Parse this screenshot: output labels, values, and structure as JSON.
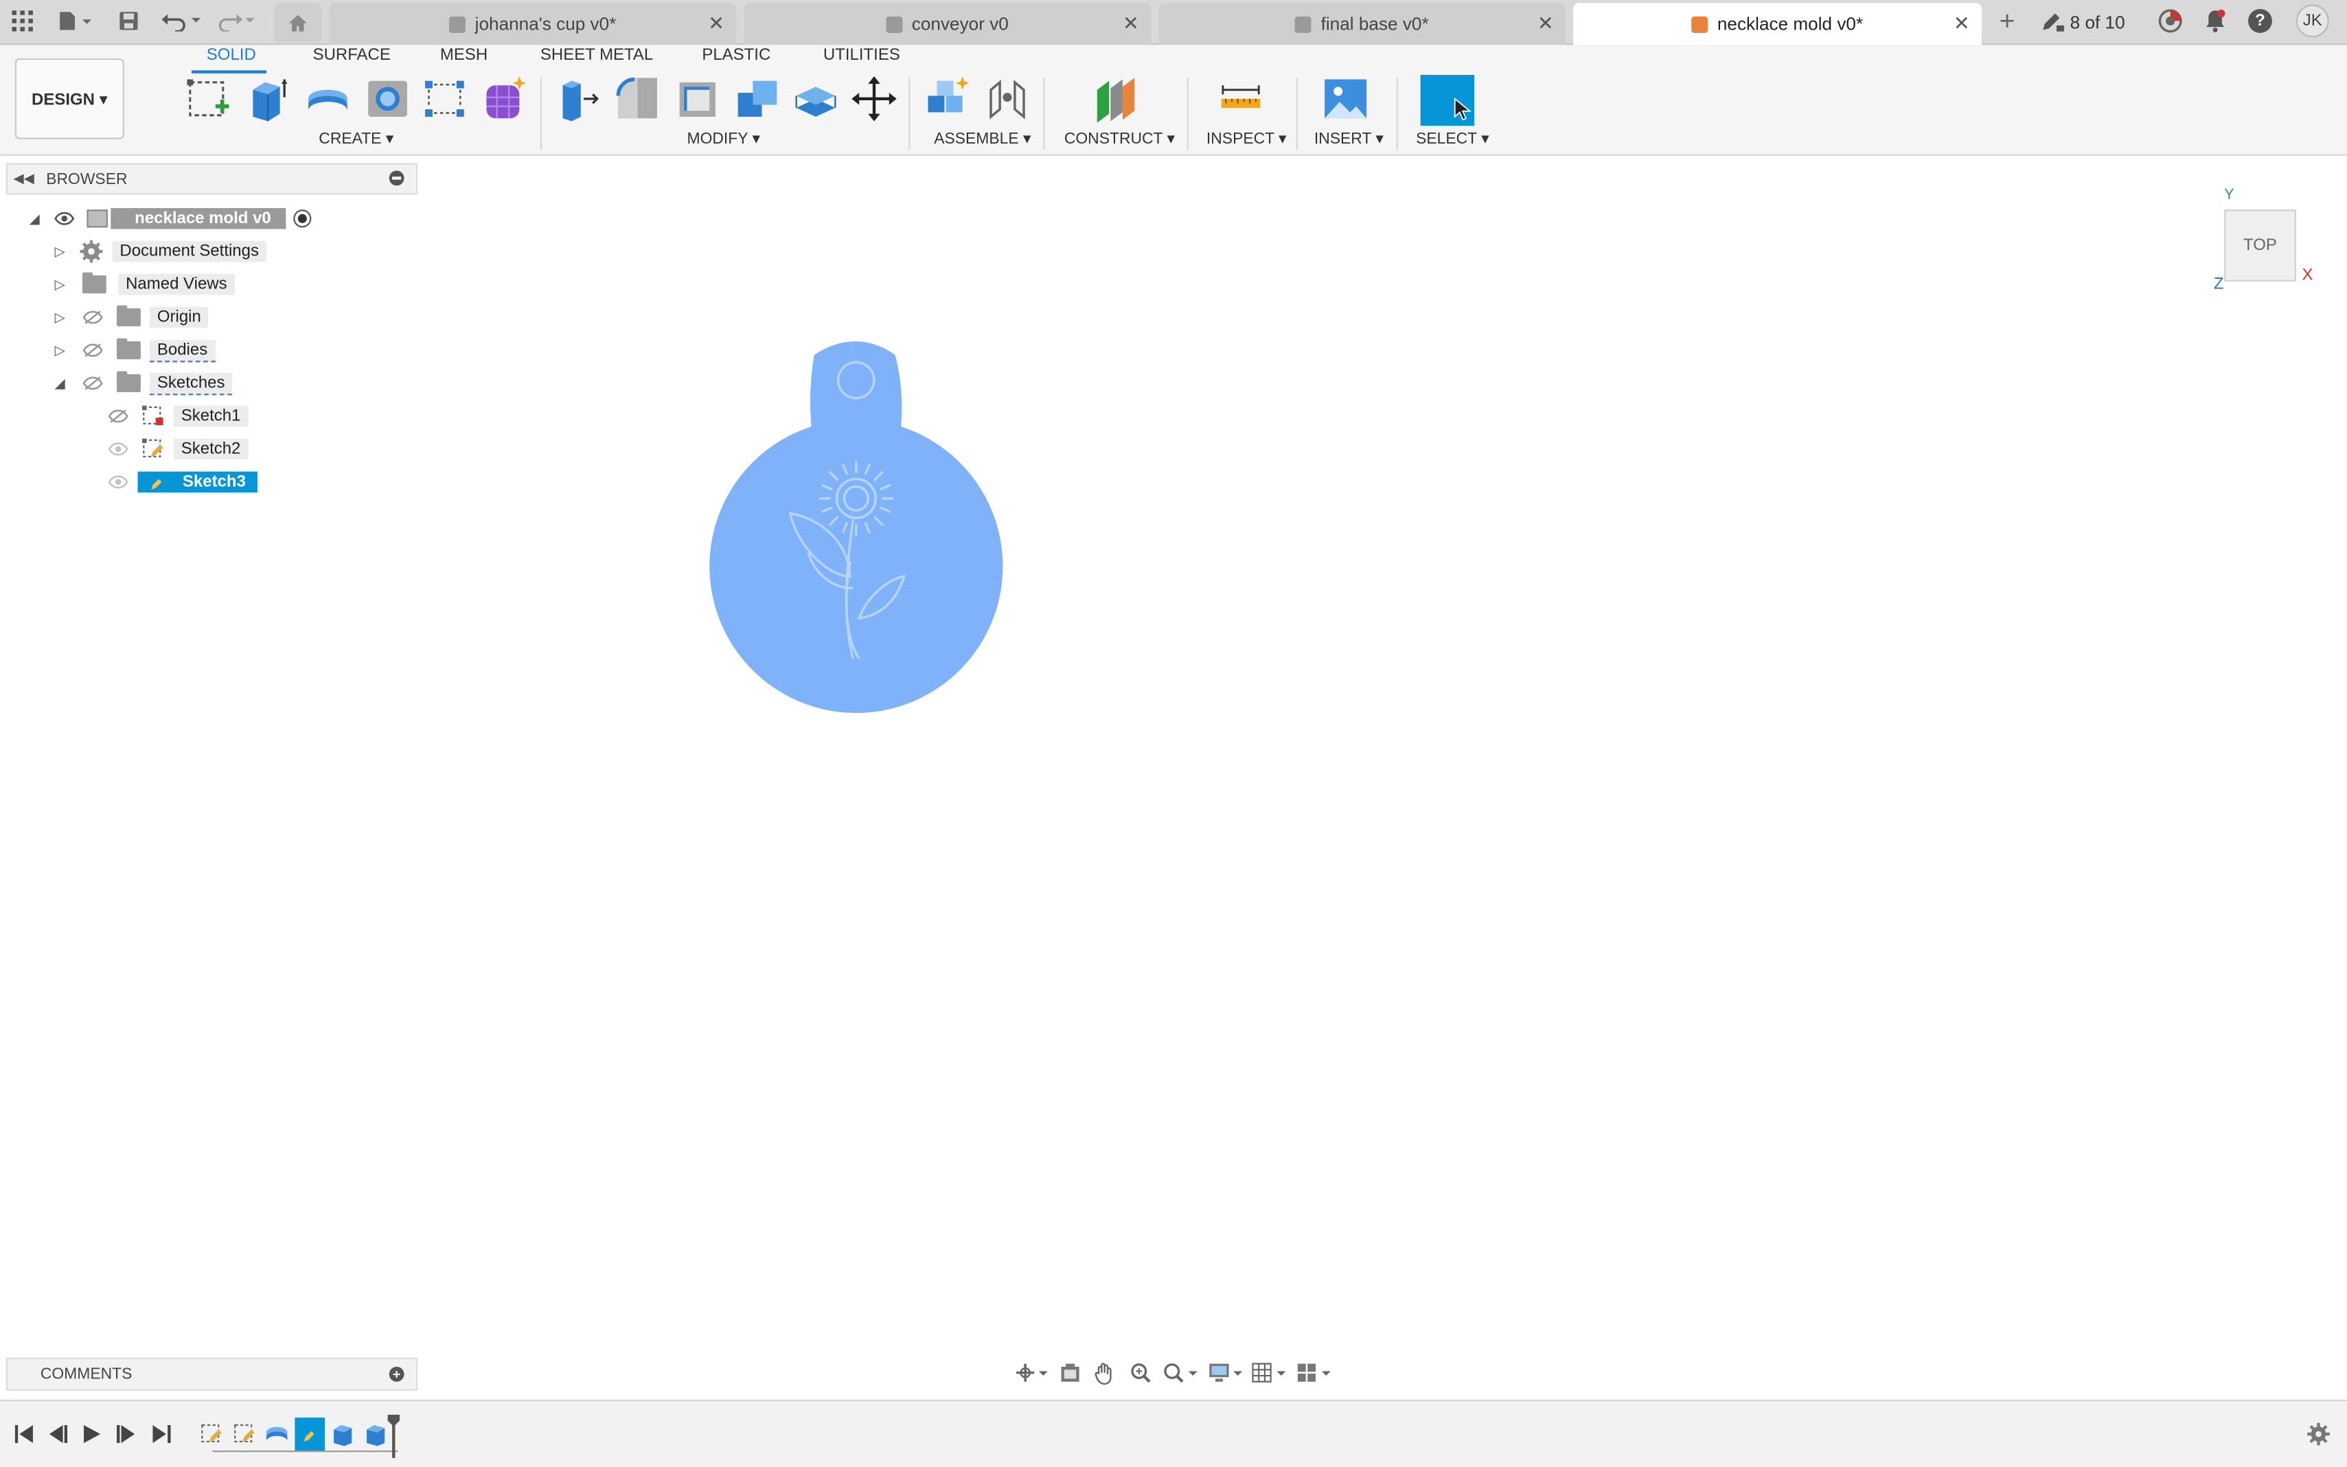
{
  "tabbar": {
    "tabs": [
      {
        "label": "johanna's cup v0*",
        "active": false
      },
      {
        "label": "conveyor v0",
        "active": false
      },
      {
        "label": "final base v0*",
        "active": false
      },
      {
        "label": "necklace mold v0*",
        "active": true
      }
    ],
    "close_glyph": "✕",
    "add_glyph": "+",
    "page_counter": "8 of 10",
    "user_initials": "JK",
    "help_glyph": "?"
  },
  "toolbar": {
    "design_label": "DESIGN ▾",
    "workspace_tabs": [
      "SOLID",
      "SURFACE",
      "MESH",
      "SHEET METAL",
      "PLASTIC",
      "UTILITIES"
    ],
    "groups": {
      "create": "CREATE ▾",
      "modify": "MODIFY ▾",
      "assemble": "ASSEMBLE ▾",
      "construct": "CONSTRUCT ▾",
      "inspect": "INSPECT ▾",
      "insert": "INSERT ▾",
      "select": "SELECT ▾"
    },
    "accent_color": "#1b7fd1"
  },
  "browser": {
    "title": "BROWSER",
    "root_component": "necklace mold v0",
    "items": [
      {
        "label": "Document Settings"
      },
      {
        "label": "Named Views"
      },
      {
        "label": "Origin"
      },
      {
        "label": "Bodies"
      },
      {
        "label": "Sketches"
      }
    ],
    "sketches": [
      {
        "label": "Sketch1"
      },
      {
        "label": "Sketch2"
      },
      {
        "label": "Sketch3",
        "selected": true
      }
    ]
  },
  "viewport": {
    "viewcube_label": "TOP",
    "axis_labels": {
      "x": "X",
      "y": "Y",
      "z": "Z"
    },
    "model_color": "#7fb2f8"
  },
  "comments": {
    "title": "COMMENTS"
  }
}
